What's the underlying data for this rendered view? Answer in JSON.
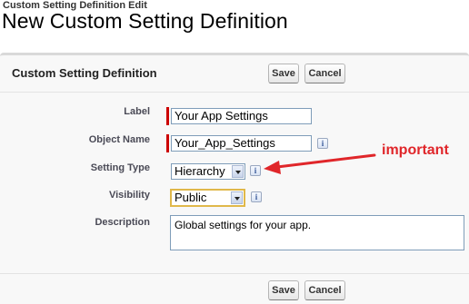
{
  "page": {
    "subtitle": "Custom Setting Definition Edit",
    "title": "New Custom Setting Definition"
  },
  "panel": {
    "title": "Custom Setting Definition",
    "save_label": "Save",
    "cancel_label": "Cancel"
  },
  "form": {
    "label": {
      "label": "Label",
      "value": "Your App Settings",
      "required": true
    },
    "object_name": {
      "label": "Object Name",
      "value": "Your_App_Settings",
      "required": true
    },
    "setting_type": {
      "label": "Setting Type",
      "value": "Hierarchy"
    },
    "visibility": {
      "label": "Visibility",
      "value": "Public"
    },
    "description": {
      "label": "Description",
      "value": "Global settings for your app."
    }
  },
  "info_icon_glyph": "i",
  "annotation": {
    "text": "important",
    "color": "#e0262a"
  },
  "colors": {
    "required_marker": "#cc0000",
    "focus_highlight": "#e0b84a"
  }
}
